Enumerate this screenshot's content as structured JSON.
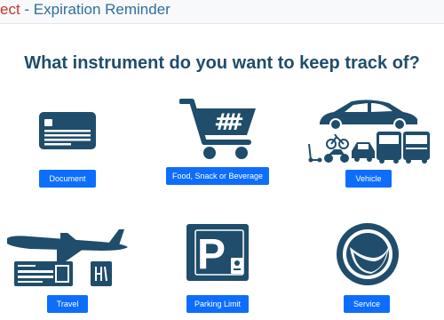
{
  "header": {
    "brand_prefix": "ect",
    "brand_separator": " - ",
    "brand_title": "Expiration Reminder"
  },
  "main": {
    "question": "What instrument do you want to keep track of?"
  },
  "options": [
    {
      "label": "Document",
      "icon": "id-card-icon"
    },
    {
      "label": "Food, Snack or Beverage",
      "icon": "shopping-cart-icon"
    },
    {
      "label": "Vehicle",
      "icon": "vehicles-icon"
    },
    {
      "label": "Travel",
      "icon": "airplane-ticket-icon"
    },
    {
      "label": "Parking Limit",
      "icon": "parking-sign-icon"
    },
    {
      "label": "Service",
      "icon": "service-badge-icon"
    }
  ],
  "colors": {
    "icon": "#1f4d6b",
    "button": "#0d6efd",
    "brand_prefix": "#c0392b",
    "brand_title": "#2f6f9f"
  }
}
